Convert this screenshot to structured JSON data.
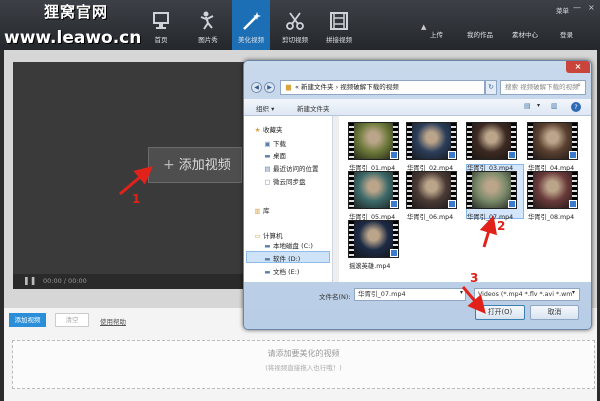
{
  "watermark": {
    "line1": "狸窝官网",
    "line2": "www.leawo.cn"
  },
  "nav": {
    "tabs": [
      {
        "label": "首页",
        "icon": "monitor-icon"
      },
      {
        "label": "图片秀",
        "icon": "dancer-icon"
      },
      {
        "label": "美化视频",
        "icon": "magic-wand-icon"
      },
      {
        "label": "剪切视频",
        "icon": "scissors-icon"
      },
      {
        "label": "拼接视频",
        "icon": "filmstrip-icon"
      }
    ],
    "active": "美化视频"
  },
  "topright": {
    "menu": "菜单",
    "minimize": "—",
    "close": "×",
    "upload": "上传",
    "my_works": "我的作品",
    "materials": "素材中心",
    "login": "登录"
  },
  "preview": {
    "add_video": "添加视频",
    "play_icon": "pause-icon",
    "time": "00:00 / 00:00"
  },
  "bottom": {
    "add_button": "添加视频",
    "clear_button": "清空",
    "help_link": "使用帮助",
    "drop_text": "请添加要美化的视频",
    "drop_hint": "(将视频直接拖入也行哦！)"
  },
  "dialog": {
    "close": "×",
    "address": "« 新建文件夹 › 视频破解下载的视频",
    "search_placeholder": "搜索 视频破解下载的视频",
    "organize": "组织 ▾",
    "new_folder": "新建文件夹",
    "help": "?",
    "sidebar": [
      {
        "label": "收藏夹",
        "icon": "star-icon",
        "glyph": "★",
        "level": 0
      },
      {
        "label": "下载",
        "icon": "download-folder-icon",
        "glyph": "▣",
        "level": 1
      },
      {
        "label": "桌面",
        "icon": "desktop-icon",
        "glyph": "▬",
        "level": 1
      },
      {
        "label": "最近访问的位置",
        "icon": "recent-places-icon",
        "glyph": "▤",
        "level": 1
      },
      {
        "label": "微云同步盘",
        "icon": "cloud-drive-icon",
        "glyph": "▢",
        "level": 1
      },
      {
        "label": "库",
        "icon": "library-icon",
        "glyph": "▥",
        "level": 0
      },
      {
        "label": "计算机",
        "icon": "computer-icon",
        "glyph": "▭",
        "level": 0
      },
      {
        "label": "本地磁盘 (C:)",
        "icon": "drive-icon",
        "glyph": "▬",
        "level": 1
      },
      {
        "label": "软件 (D:)",
        "icon": "drive-icon",
        "glyph": "▬",
        "level": 1
      },
      {
        "label": "文档 (E:)",
        "icon": "drive-icon",
        "glyph": "▬",
        "level": 1
      }
    ],
    "files": [
      {
        "name": "华胥引_01.mp4",
        "color": "#6d7a3a"
      },
      {
        "name": "华胥引_02.mp4",
        "color": "#2c3e5a"
      },
      {
        "name": "华胥引_03.mp4",
        "color": "#3d2a22"
      },
      {
        "name": "华胥引_04.mp4",
        "color": "#5a4030"
      },
      {
        "name": "华胥引_05.mp4",
        "color": "#3e6a6a"
      },
      {
        "name": "华胥引_06.mp4",
        "color": "#4a3a35"
      },
      {
        "name": "华胥引_07.mp4",
        "color": "#7a8a6a"
      },
      {
        "name": "华胥引_08.mp4",
        "color": "#6a3a3a"
      },
      {
        "name": "摇滚英雄.mp4",
        "color": "#1c2a44"
      }
    ],
    "selected_file": "华胥引_07.mp4",
    "filename_label": "文件名(N):",
    "filename_value": "华胥引_07.mp4",
    "filetype_value": "Videos (*.mp4 *.flv *.avi *.wm",
    "open_button": "打开(O)",
    "cancel_button": "取消"
  },
  "annotations": {
    "mark1": "1",
    "mark2": "2",
    "mark3": "3"
  }
}
